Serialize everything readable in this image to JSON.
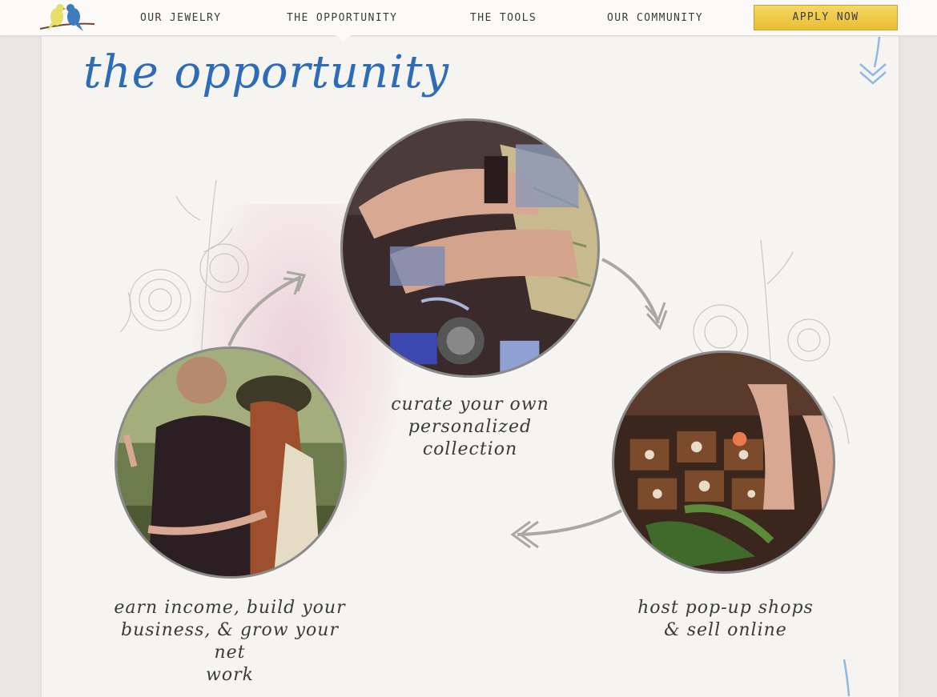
{
  "nav": {
    "items": [
      {
        "label": "OUR JEWELRY"
      },
      {
        "label": "THE OPPORTUNITY"
      },
      {
        "label": "THE TOOLS"
      },
      {
        "label": "OUR COMMUNITY"
      }
    ],
    "apply_label": "APPLY NOW",
    "active": "THE OPPORTUNITY"
  },
  "page": {
    "title": "the opportunity"
  },
  "steps": [
    {
      "caption_lines": [
        "curate your own",
        "personalized",
        "collection"
      ],
      "image": "hands-with-bracelets-photo"
    },
    {
      "caption_lines": [
        "host pop-up shops",
        "& sell online"
      ],
      "image": "jewelry-box-photo"
    },
    {
      "caption_lines": [
        "earn income, build your",
        "business, & grow your net",
        "work"
      ],
      "image": "friends-embracing-photo"
    }
  ],
  "colors": {
    "accent_blue": "#2e6cb8",
    "button_yellow": "#f0cd4f",
    "background": "#f6f4f0"
  }
}
